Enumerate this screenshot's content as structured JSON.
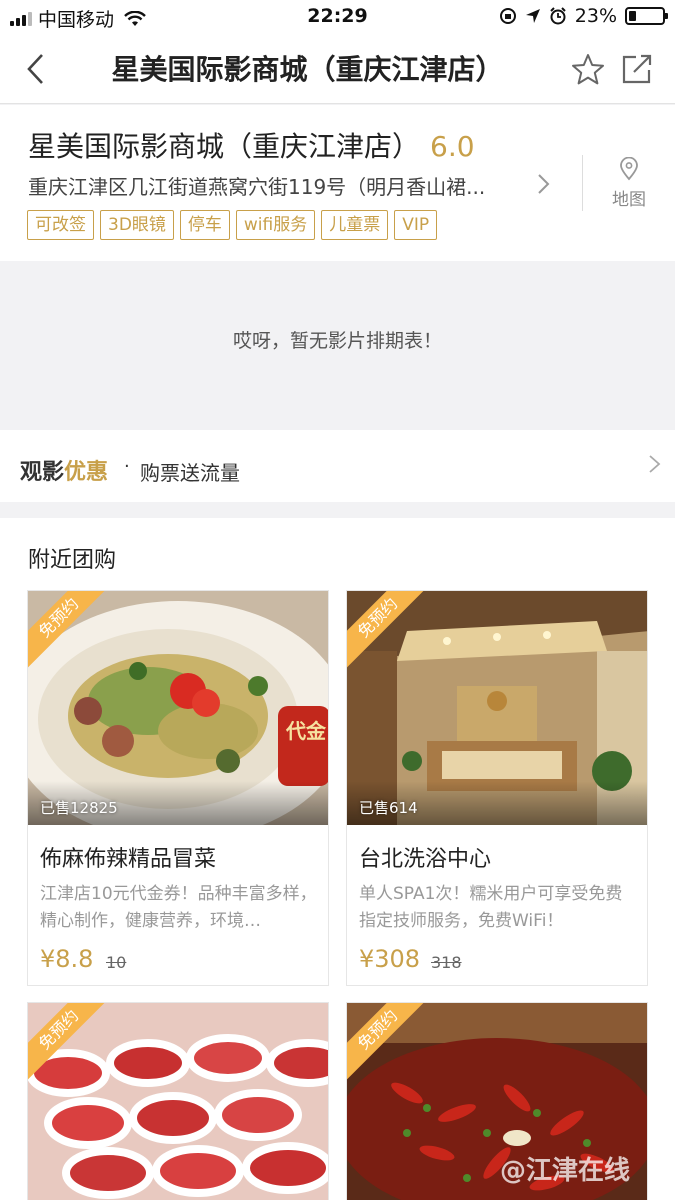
{
  "status_bar": {
    "carrier": "中国移动",
    "time": "22:29",
    "battery_text": "23%",
    "battery_level": 0.23
  },
  "nav": {
    "title": "星美国际影商城（重庆江津店）",
    "back_icon": "chevron-left-icon",
    "star_icon": "star-outline-icon",
    "share_icon": "share-icon"
  },
  "cinema": {
    "name": "星美国际影商城（重庆江津店）",
    "score": "6.0",
    "address": "重庆江津区几江街道燕窝穴街119号（明月香山裙...",
    "map_label": "地图",
    "tags": [
      "可改签",
      "3D眼镜",
      "停车",
      "wifi服务",
      "儿童票",
      "VIP"
    ]
  },
  "schedule": {
    "empty_text": "哎呀，暂无影片排期表！"
  },
  "promo": {
    "title_part1": "观影",
    "title_part2": "优惠",
    "separator": "·",
    "description": "购票送流量"
  },
  "nearby": {
    "title": "附近团购",
    "deals": [
      {
        "ribbon": "免预约",
        "sold": "已售12825",
        "name": "佈麻佈辣精品冒菜",
        "description": "江津店10元代金券！品种丰富多样，精心制作，健康营养，环境…",
        "price": "¥8.8",
        "original_price": "10",
        "image_overlay_text": "代金"
      },
      {
        "ribbon": "免预约",
        "sold": "已售614",
        "name": "台北洗浴中心",
        "description": "单人SPA1次！糯米用户可享受免费指定技师服务，免费WiFi！",
        "price": "¥308",
        "original_price": "318"
      },
      {
        "ribbon": "免预约"
      },
      {
        "ribbon": "免预约"
      }
    ]
  },
  "watermark": "@江津在线",
  "colors": {
    "accent": "#c8a04a",
    "ribbon": "#f7b54a",
    "background": "#f2f2f4"
  }
}
